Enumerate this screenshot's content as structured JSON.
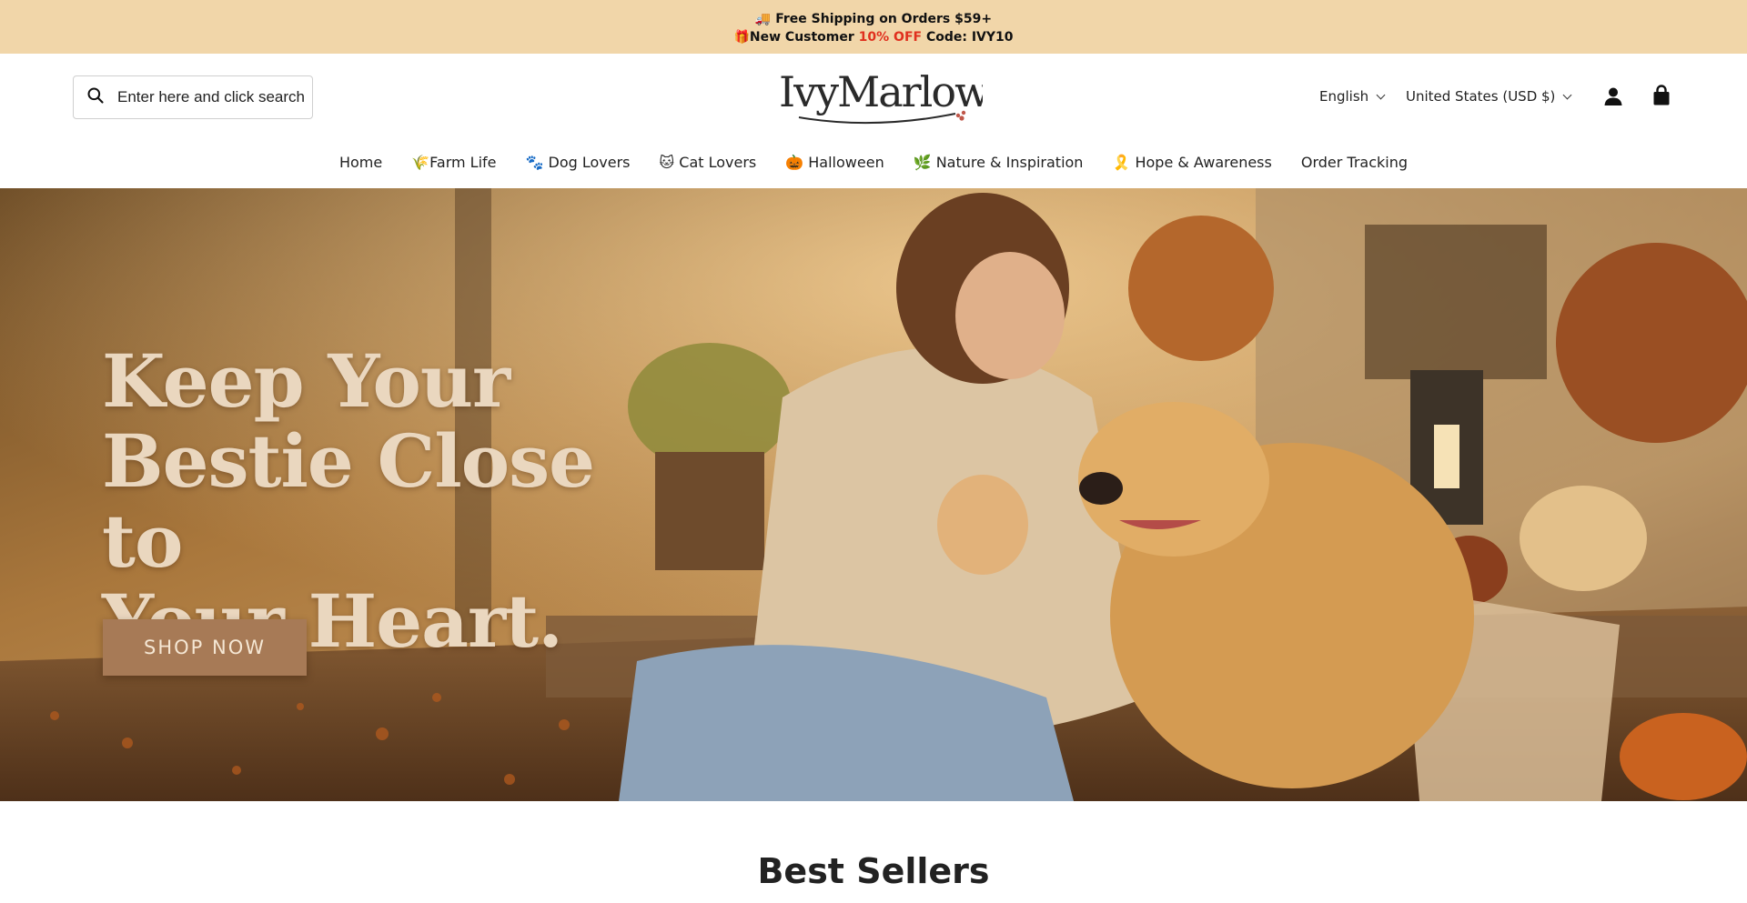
{
  "announcement": {
    "line1": "🚚 Free Shipping on Orders $59+",
    "line2_prefix": "🎁New Customer ",
    "line2_accent": "10% OFF",
    "line2_suffix": " Code: IVY10",
    "background": "#f1d6a9",
    "accent_color": "#e0301e"
  },
  "header": {
    "search": {
      "placeholder": "Enter here and click search",
      "icon": "search-icon"
    },
    "logo_text": "IvyMarlow",
    "language": "English",
    "currency": "United States (USD $)",
    "account_icon": "person-icon",
    "cart_icon": "shopping-bag-icon"
  },
  "nav": {
    "items": [
      {
        "label": "Home"
      },
      {
        "label": "🌾Farm Life"
      },
      {
        "label": "🐾 Dog Lovers"
      },
      {
        "label": "🐱 Cat Lovers"
      },
      {
        "label": "🎃 Halloween"
      },
      {
        "label": "🌿 Nature & Inspiration"
      },
      {
        "label": "🎗️ Hope & Awareness"
      },
      {
        "label": "Order Tracking"
      }
    ]
  },
  "hero": {
    "title_line1": "Keep Your",
    "title_line2": "Bestie Close to",
    "title_line3": "Your Heart.",
    "cta": "SHOP NOW"
  },
  "best_sellers": {
    "title": "Best Sellers"
  }
}
